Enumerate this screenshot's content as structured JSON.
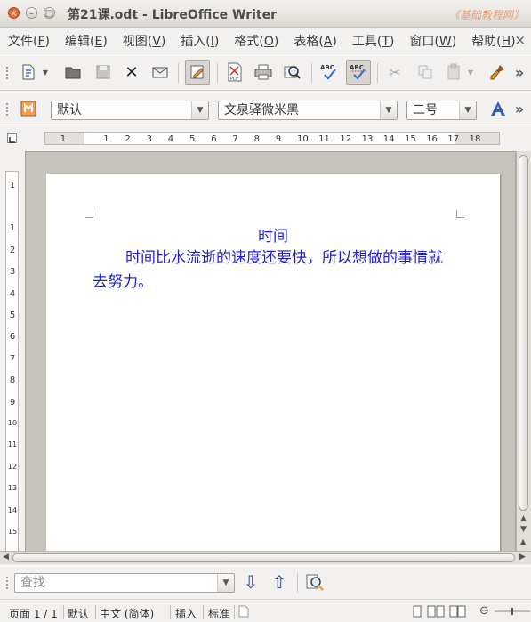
{
  "window": {
    "title": "第21课.odt - LibreOffice Writer",
    "watermark": "《基础教程网》",
    "close_glyph": "×",
    "minimize_glyph": "–",
    "maximize_glyph": "□"
  },
  "menubar": {
    "items": [
      {
        "label": "文件(",
        "mnemonic": "F",
        "suffix": ")"
      },
      {
        "label": "编辑(",
        "mnemonic": "E",
        "suffix": ")"
      },
      {
        "label": "视图(",
        "mnemonic": "V",
        "suffix": ")"
      },
      {
        "label": "插入(",
        "mnemonic": "I",
        "suffix": ")"
      },
      {
        "label": "格式(",
        "mnemonic": "O",
        "suffix": ")"
      },
      {
        "label": "表格(",
        "mnemonic": "A",
        "suffix": ")"
      },
      {
        "label": "工具(",
        "mnemonic": "T",
        "suffix": ")"
      },
      {
        "label": "窗口(",
        "mnemonic": "W",
        "suffix": ")"
      },
      {
        "label": "帮助(",
        "mnemonic": "H",
        "suffix": ")"
      }
    ],
    "close_glyph": "×"
  },
  "standard_toolbar": {
    "icons": [
      "new-document-icon",
      "dropdown-arrow-icon",
      "open-icon",
      "save-icon",
      "cut-x-icon",
      "email-icon",
      "edit-mode-icon",
      "export-pdf-icon",
      "print-icon",
      "print-preview-icon",
      "spellcheck-icon",
      "autospellcheck-icon",
      "scissors-icon",
      "copy-icon",
      "paste-icon",
      "format-paintbrush-icon",
      "overflow-icon"
    ],
    "pdf_label": "PDF",
    "abc_label": "ABC",
    "overflow_glyph": "»"
  },
  "formatting_toolbar": {
    "paragraph_style": "默认",
    "font_name": "文泉驿微米黑",
    "font_size": "二号",
    "overflow_glyph": "»"
  },
  "ruler": {
    "h_numbers": [
      "1",
      "1",
      "2",
      "3",
      "4",
      "5",
      "6",
      "7",
      "8",
      "9",
      "10",
      "11",
      "12",
      "13",
      "14",
      "15",
      "16",
      "17",
      "18"
    ],
    "v_numbers": [
      "1",
      "1",
      "2",
      "3",
      "4",
      "5",
      "6",
      "7",
      "8",
      "9",
      "10",
      "11",
      "12",
      "13",
      "14",
      "15"
    ],
    "corner_glyph": "L"
  },
  "document": {
    "heading": "时间",
    "body": "时间比水流逝的速度还要快，所以想做的事情就去努力。",
    "text_color": "#1f1fd0"
  },
  "find_toolbar": {
    "placeholder": "查找",
    "down_glyph": "⇩",
    "up_glyph": "⇧"
  },
  "statusbar": {
    "page": "页面 1 / 1",
    "style": "默认",
    "language": "中文 (简体)",
    "insert_mode": "插入",
    "selection_mode": "标准"
  }
}
